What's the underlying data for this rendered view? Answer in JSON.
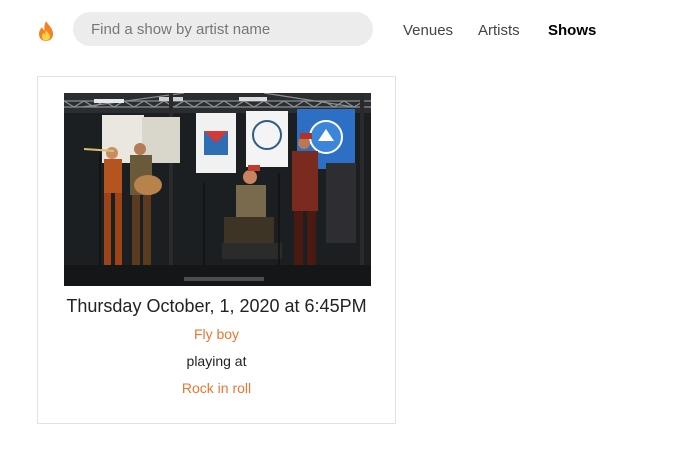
{
  "header": {
    "logo_icon": "fire-icon",
    "search": {
      "placeholder": "Find a show by artist name",
      "value": ""
    },
    "nav": [
      {
        "label": "Venues",
        "active": false
      },
      {
        "label": "Artists",
        "active": false
      },
      {
        "label": "Shows",
        "active": true
      }
    ]
  },
  "shows": [
    {
      "datetime": "Thursday October, 1, 2020 at 6:45PM",
      "artist": "Fly boy",
      "connector": "playing at",
      "venue": "Rock in roll",
      "image_alt": "band performing on stage"
    }
  ],
  "colors": {
    "accent": "#e8772e",
    "search_bg": "#ececec",
    "card_border": "#e2e2e2"
  }
}
